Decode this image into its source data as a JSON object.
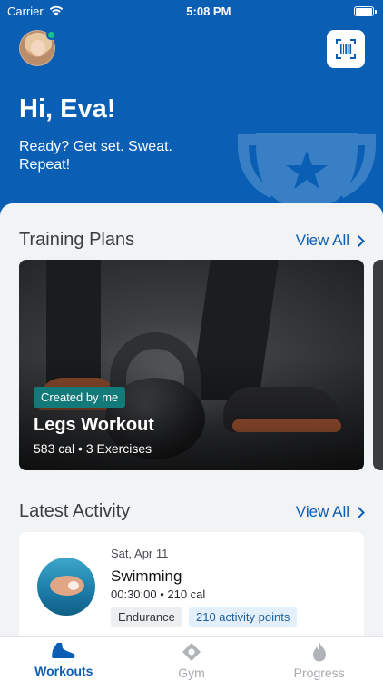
{
  "status_bar": {
    "carrier": "Carrier",
    "time": "5:08 PM"
  },
  "header": {
    "greeting": "Hi, Eva!",
    "tagline": "Ready? Get set. Sweat. Repeat!",
    "accent_color": "#0a5fb4",
    "online_color": "#16c28b"
  },
  "training_plans": {
    "title": "Training Plans",
    "view_all": "View All",
    "cards": [
      {
        "badge": "Created by me",
        "title": "Legs Workout",
        "meta": "583 cal • 3 Exercises"
      }
    ]
  },
  "latest_activity": {
    "title": "Latest Activity",
    "view_all": "View All",
    "items": [
      {
        "date": "Sat, Apr 11",
        "title": "Swimming",
        "meta": "00:30:00 • 210 cal",
        "tags": [
          "Endurance",
          "210 activity points"
        ]
      }
    ]
  },
  "tabbar": {
    "tabs": [
      {
        "label": "Workouts",
        "icon": "shoe-icon",
        "active": true
      },
      {
        "label": "Gym",
        "icon": "location-pin-icon",
        "active": false
      },
      {
        "label": "Progress",
        "icon": "flame-icon",
        "active": false
      }
    ]
  }
}
